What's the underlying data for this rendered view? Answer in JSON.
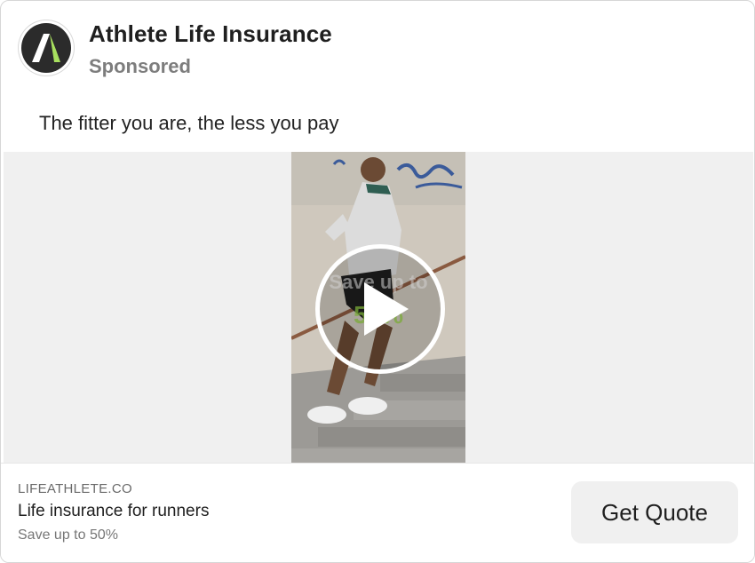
{
  "ad": {
    "page_name": "Athlete Life Insurance",
    "sponsored_label": "Sponsored",
    "caption": "The fitter you are, the less you pay",
    "logo_icon": "athlete-a-logo-icon",
    "brand_accent": "#a8e05f"
  },
  "media": {
    "overlay_text": "Save up to",
    "overlay_percent": "50%",
    "play_icon": "play-icon"
  },
  "footer": {
    "domain": "LIFEATHLETE.CO",
    "headline": "Life insurance for runners",
    "description": "Save up to 50%",
    "cta_label": "Get Quote"
  }
}
